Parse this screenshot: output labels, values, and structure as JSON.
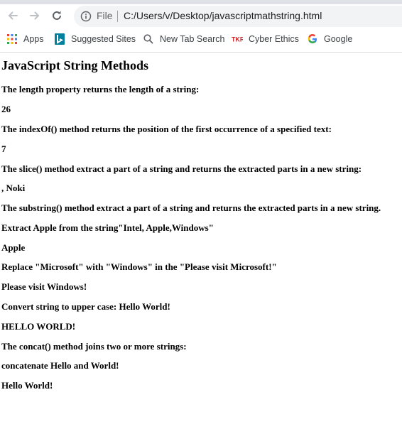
{
  "browser": {
    "url_scheme_label": "File",
    "url": "C:/Users/v/Desktop/javascriptmathstring.html",
    "bookmarks": [
      {
        "label": "Apps",
        "icon": "apps-grid-icon"
      },
      {
        "label": "Suggested Sites",
        "icon": "bing-icon"
      },
      {
        "label": "New Tab Search",
        "icon": "search-icon"
      },
      {
        "label": "Cyber Ethics",
        "icon": "tkr-icon"
      },
      {
        "label": "Google",
        "icon": "google-icon"
      }
    ]
  },
  "page": {
    "heading": "JavaScript String Methods",
    "lines": [
      "The length property returns the length of a string:",
      "26",
      "The indexOf() method returns the position of the first occurrence of a specified text:",
      "7",
      "The slice() method extract a part of a string and returns the extracted parts in a new string:",
      ", Noki",
      "The substring() method extract a part of a string and returns the extracted parts in a new string.",
      "Extract Apple from the string\"Intel, Apple,Windows\"",
      "Apple",
      "Replace \"Microsoft\" with \"Windows\" in the \"Please visit Microsoft!\"",
      "Please visit Windows!",
      "Convert string to upper case: Hello World!",
      "HELLO WORLD!",
      "The concat() method joins two or more strings:",
      "concatenate Hello and World!",
      "Hello World!"
    ]
  }
}
